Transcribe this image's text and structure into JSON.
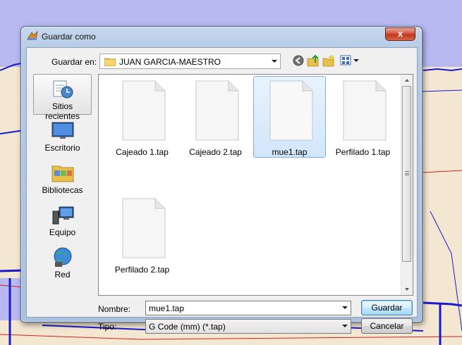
{
  "window": {
    "title": "Guardar como",
    "close_label": "x"
  },
  "location": {
    "label": "Guardar en:",
    "current_folder": "JUAN GARCIA-MAESTRO"
  },
  "places": [
    {
      "label": "Sitios recientes",
      "icon": "recent-places-icon",
      "selected": true
    },
    {
      "label": "Escritorio",
      "icon": "desktop-icon",
      "selected": false
    },
    {
      "label": "Bibliotecas",
      "icon": "libraries-icon",
      "selected": false
    },
    {
      "label": "Equipo",
      "icon": "computer-icon",
      "selected": false
    },
    {
      "label": "Red",
      "icon": "network-icon",
      "selected": false
    }
  ],
  "files": [
    {
      "name": "Cajeado 1.tap",
      "selected": false
    },
    {
      "name": "Cajeado 2.tap",
      "selected": false
    },
    {
      "name": "mue1.tap",
      "selected": true
    },
    {
      "name": "Perfilado 1.tap",
      "selected": false
    },
    {
      "name": "Perfilado 2.tap",
      "selected": false
    }
  ],
  "fields": {
    "name_label": "Nombre:",
    "name_value": "mue1.tap",
    "type_label": "Tipo:",
    "type_value": "G Code (mm) (*.tap)"
  },
  "buttons": {
    "save": "Guardar",
    "cancel": "Cancelar"
  }
}
